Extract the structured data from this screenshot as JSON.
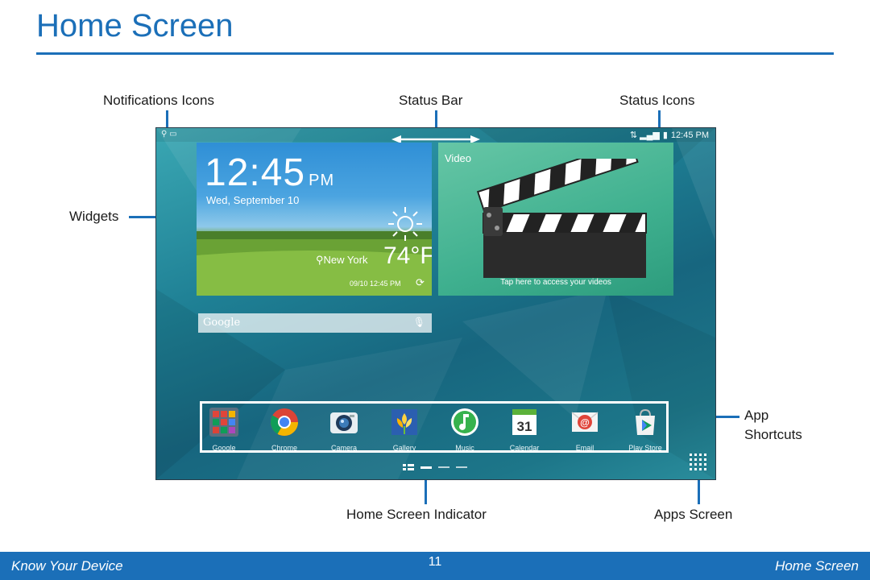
{
  "page": {
    "title": "Home Screen"
  },
  "callouts": {
    "notifications_icons": "Notifications Icons",
    "status_bar": "Status Bar",
    "status_icons": "Status Icons",
    "widgets": "Widgets",
    "app_shortcuts_line1": "App",
    "app_shortcuts_line2": "Shortcuts",
    "home_screen_indicator": "Home Screen Indicator",
    "apps_screen": "Apps Screen"
  },
  "device": {
    "status_bar": {
      "left_icons": "⚲ ▭",
      "right_icons": "⇅ ▂▄▆",
      "battery": "▮",
      "time": "12:45 PM"
    },
    "clock_widget": {
      "time": "12:45",
      "ampm": "PM",
      "date": "Wed, September 10",
      "city": "New York",
      "temperature": "74°F",
      "updated": "09/10 12:45 PM",
      "refresh_icon": "refresh-icon"
    },
    "video_widget": {
      "title": "Video",
      "caption": "Tap here to access your videos"
    },
    "search": {
      "logo": "Google",
      "mic_icon": "microphone-icon"
    },
    "apps": [
      {
        "label": "Google",
        "icon": "google-folder-icon"
      },
      {
        "label": "Chrome",
        "icon": "chrome-icon"
      },
      {
        "label": "Camera",
        "icon": "camera-icon"
      },
      {
        "label": "Gallery",
        "icon": "gallery-icon"
      },
      {
        "label": "Music",
        "icon": "music-icon"
      },
      {
        "label": "Calendar",
        "icon": "calendar-icon",
        "badge": "31"
      },
      {
        "label": "Email",
        "icon": "email-icon",
        "badge": "@"
      },
      {
        "label": "Play Store",
        "icon": "play-store-icon"
      }
    ]
  },
  "footer": {
    "left": "Know Your Device",
    "page_number": "11",
    "right": "Home Screen"
  },
  "colors": {
    "accent": "#1b6fb8",
    "wallpaper": "#1e7f94"
  }
}
